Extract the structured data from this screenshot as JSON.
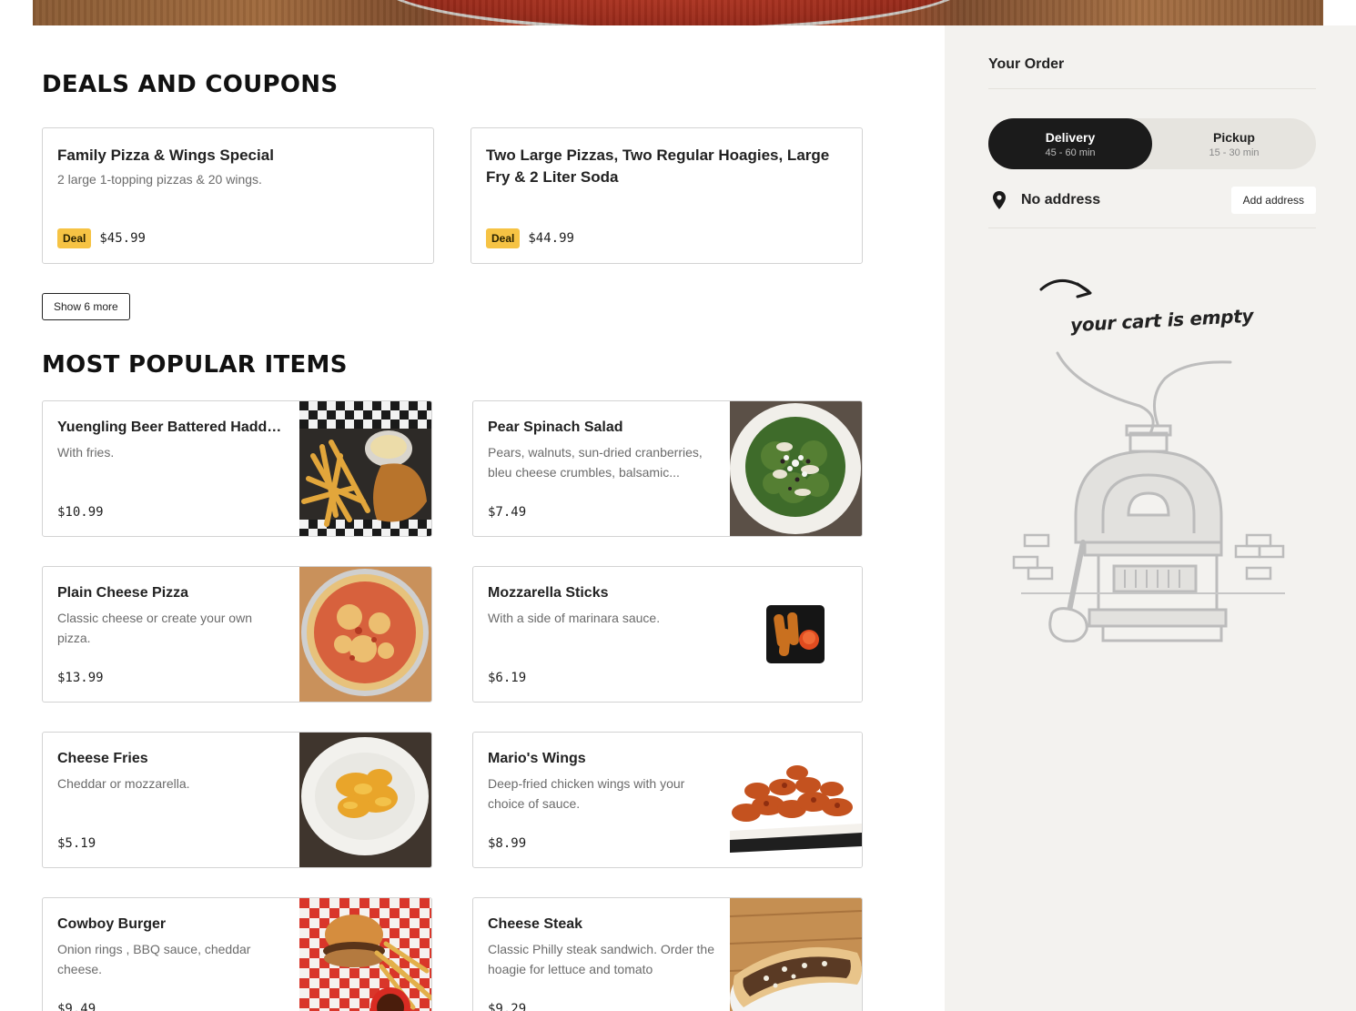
{
  "deals": {
    "title": "DEALS AND COUPONS",
    "cards": [
      {
        "name": "Family Pizza & Wings Special",
        "desc": "2 large 1-topping pizzas & 20 wings.",
        "badge": "Deal",
        "price": "$45.99"
      },
      {
        "name": "Two Large Pizzas, Two Regular Hoagies, Large Fry & 2 Liter Soda",
        "desc": "",
        "badge": "Deal",
        "price": "$44.99"
      }
    ],
    "show_more_label": "Show 6 more"
  },
  "popular": {
    "title": "MOST POPULAR ITEMS",
    "items": [
      {
        "name": "Yuengling Beer Battered Haddo...",
        "desc": "With fries.",
        "price": "$10.99",
        "photo": "fish-and-chips-photo"
      },
      {
        "name": "Pear Spinach Salad",
        "desc": "Pears, walnuts, sun-dried cranberries, bleu cheese crumbles, balsamic...",
        "price": "$7.49",
        "photo": "salad-photo"
      },
      {
        "name": "Plain Cheese Pizza",
        "desc": "Classic cheese or create your own pizza.",
        "price": "$13.99",
        "photo": "cheese-pizza-photo"
      },
      {
        "name": "Mozzarella Sticks",
        "desc": "With a side of marinara sauce.",
        "price": "$6.19",
        "photo": "mozzarella-sticks-photo"
      },
      {
        "name": "Cheese Fries",
        "desc": "Cheddar or mozzarella.",
        "price": "$5.19",
        "photo": "cheese-fries-photo"
      },
      {
        "name": "Mario's Wings",
        "desc": "Deep-fried chicken wings with your choice of sauce.",
        "price": "$8.99",
        "photo": "wings-photo"
      },
      {
        "name": "Cowboy Burger",
        "desc": "Onion rings , BBQ sauce, cheddar cheese.",
        "price": "$9.49",
        "photo": "burger-photo"
      },
      {
        "name": "Cheese Steak",
        "desc": "Classic Philly steak sandwich. Order the hoagie for lettuce and tomato",
        "price": "$9.29",
        "photo": "cheese-steak-photo"
      }
    ]
  },
  "order": {
    "title": "Your Order",
    "delivery": {
      "label": "Delivery",
      "time": "45 - 60 min"
    },
    "pickup": {
      "label": "Pickup",
      "time": "15 - 30 min"
    },
    "address_text": "No address",
    "add_address_label": "Add address",
    "empty_text": "your cart is empty"
  },
  "colors": {
    "deal_badge": "#f6c344",
    "sidebar_bg": "#f3f2ef",
    "active_toggle": "#1b1b1b"
  }
}
